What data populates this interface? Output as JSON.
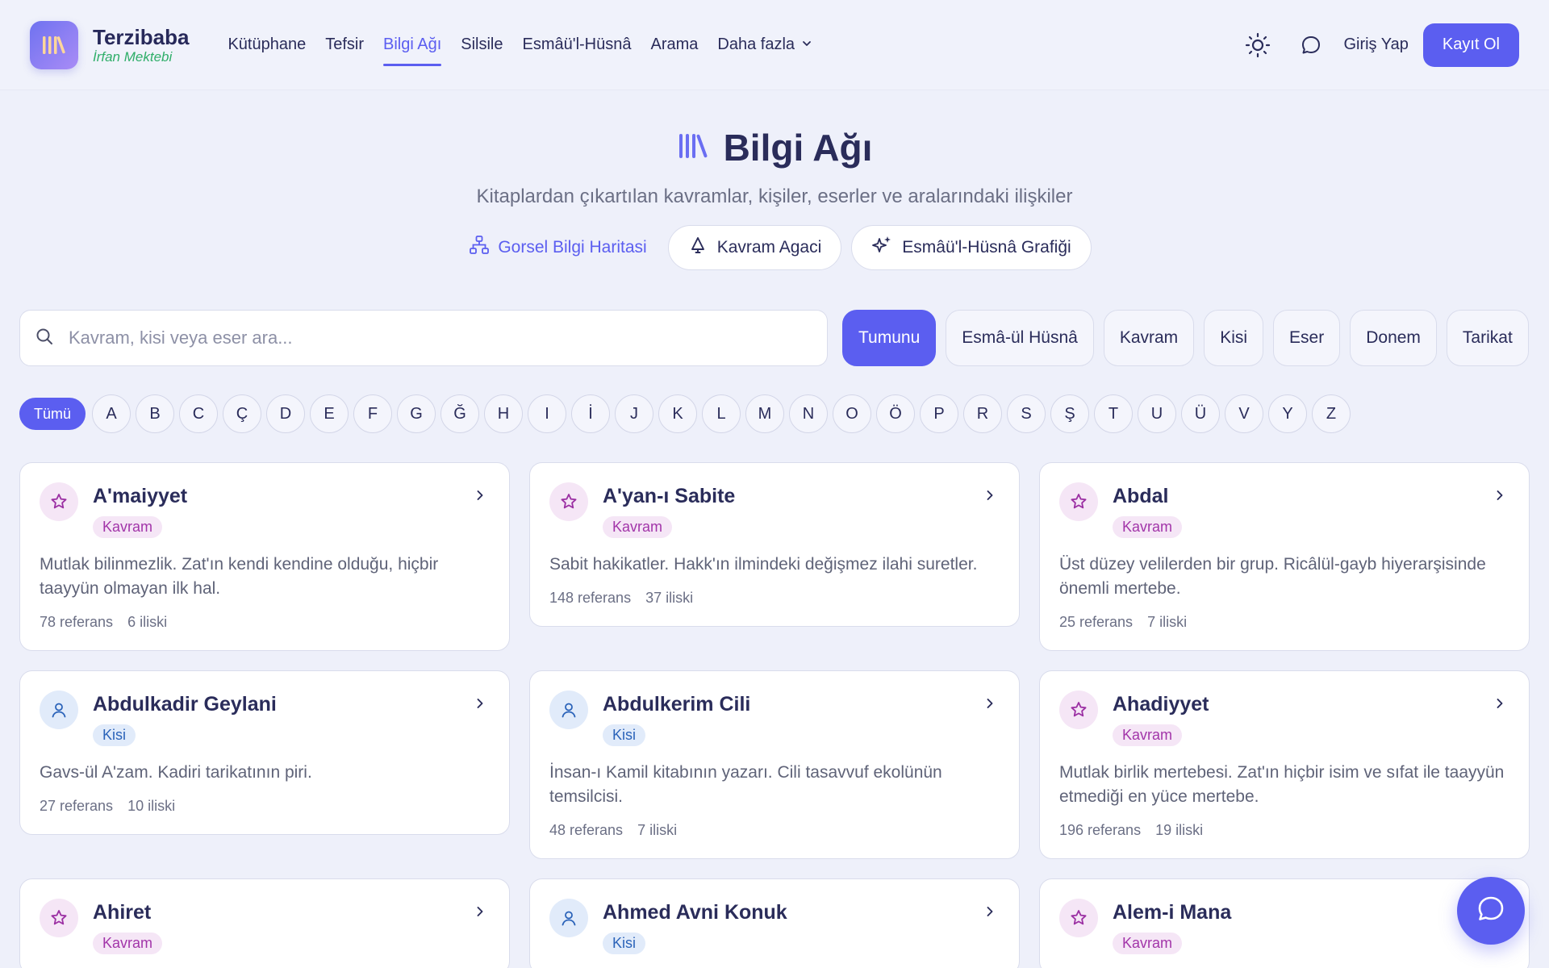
{
  "brand": {
    "name": "Terzibaba",
    "subtitle": "İrfan Mektebi"
  },
  "nav": {
    "items": [
      "Kütüphane",
      "Tefsir",
      "Bilgi Ağı",
      "Silsile",
      "Esmâü'l-Hüsnâ",
      "Arama"
    ],
    "active": "Bilgi Ağı",
    "more_label": "Daha fazla"
  },
  "header": {
    "login_label": "Giriş Yap",
    "signup_label": "Kayıt Ol"
  },
  "hero": {
    "title": "Bilgi Ağı",
    "subtitle": "Kitaplardan çıkartılan kavramlar, kişiler, eserler ve aralarındaki ilişkiler",
    "links": {
      "map": "Gorsel Bilgi Haritasi",
      "tree": "Kavram Agaci",
      "graph": "Esmâü'l-Hüsnâ Grafiği"
    }
  },
  "search": {
    "placeholder": "Kavram, kisi veya eser ara..."
  },
  "filters": [
    "Tumunu",
    "Esmâ-ül Hüsnâ",
    "Kavram",
    "Kisi",
    "Eser",
    "Donem",
    "Tarikat"
  ],
  "letters": {
    "all_label": "Tümü",
    "items": [
      "A",
      "B",
      "C",
      "Ç",
      "D",
      "E",
      "F",
      "G",
      "Ğ",
      "H",
      "I",
      "İ",
      "J",
      "K",
      "L",
      "M",
      "N",
      "O",
      "Ö",
      "P",
      "R",
      "S",
      "Ş",
      "T",
      "U",
      "Ü",
      "V",
      "Y",
      "Z"
    ]
  },
  "cards": [
    {
      "title": "A'maiyyet",
      "type": "Kavram",
      "icon": "star-icon",
      "desc": "Mutlak bilinmezlik. Zat'ın kendi kendine olduğu, hiçbir taayyün olmayan ilk hal.",
      "refs": "78 referans",
      "rels": "6 iliski"
    },
    {
      "title": "A'yan-ı Sabite",
      "type": "Kavram",
      "icon": "star-icon",
      "desc": "Sabit hakikatler. Hakk'ın ilmindeki değişmez ilahi suretler.",
      "refs": "148 referans",
      "rels": "37 iliski"
    },
    {
      "title": "Abdal",
      "type": "Kavram",
      "icon": "star-icon",
      "desc": "Üst düzey velilerden bir grup. Ricâlül-gayb hiyerarşisinde önemli mertebe.",
      "refs": "25 referans",
      "rels": "7 iliski"
    },
    {
      "title": "Abdulkadir Geylani",
      "type": "Kisi",
      "icon": "person-icon",
      "desc": "Gavs-ül A'zam. Kadiri tarikatının piri.",
      "refs": "27 referans",
      "rels": "10 iliski"
    },
    {
      "title": "Abdulkerim Cili",
      "type": "Kisi",
      "icon": "person-icon",
      "desc": "İnsan-ı Kamil kitabının yazarı. Cili tasavvuf ekolünün temsilcisi.",
      "refs": "48 referans",
      "rels": "7 iliski"
    },
    {
      "title": "Ahadiyyet",
      "type": "Kavram",
      "icon": "star-icon",
      "desc": "Mutlak birlik mertebesi. Zat'ın hiçbir isim ve sıfat ile taayyün etmediği en yüce mertebe.",
      "refs": "196 referans",
      "rels": "19 iliski"
    },
    {
      "title": "Ahiret",
      "type": "Kavram",
      "icon": "star-icon",
      "desc": "",
      "refs": "",
      "rels": ""
    },
    {
      "title": "Ahmed Avni Konuk",
      "type": "Kisi",
      "icon": "person-icon",
      "desc": "",
      "refs": "",
      "rels": ""
    },
    {
      "title": "Alem-i Mana",
      "type": "Kavram",
      "icon": "star-icon",
      "desc": "",
      "refs": "",
      "rels": ""
    }
  ],
  "colors": {
    "accent": "#5b5ef0",
    "kavram_tag": "#a235a9",
    "kisi_tag": "#2b63b9",
    "brand_sub": "#2fae69"
  }
}
